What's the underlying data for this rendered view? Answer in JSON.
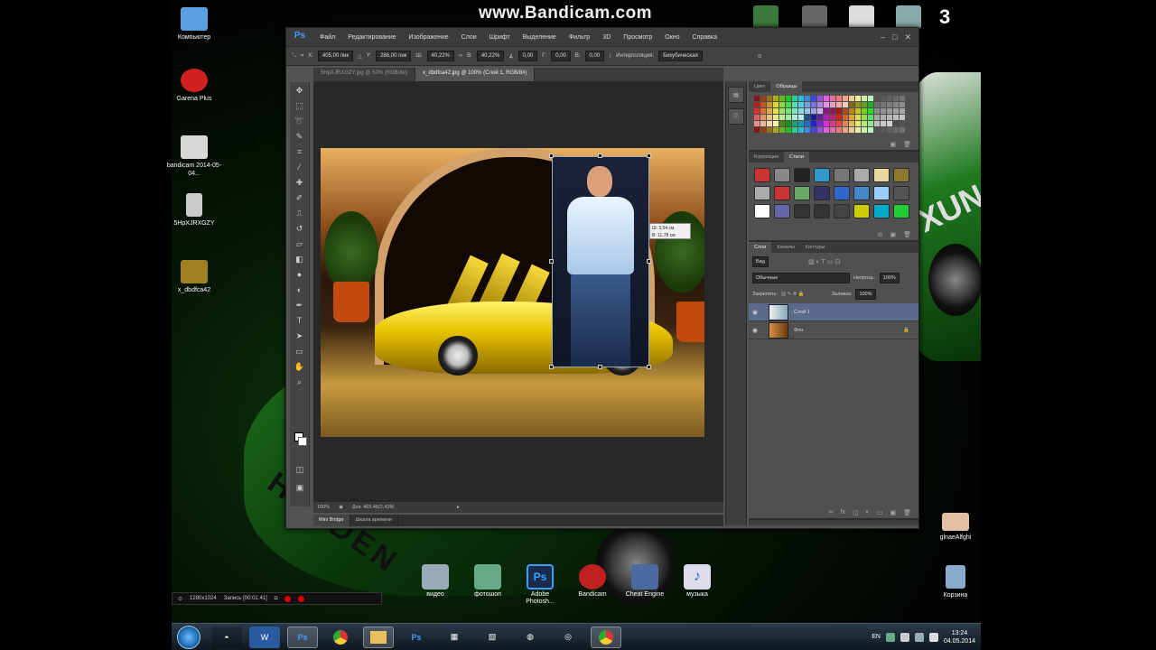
{
  "watermark": "www.Bandicam.com",
  "desktop": {
    "icons": [
      {
        "label": "Компьютер",
        "color": "#5aa0e0"
      },
      {
        "label": "Garena Plus",
        "color": "#d02020"
      },
      {
        "label": "bandicam 2014-05-04...",
        "color": "#d8d8d8"
      },
      {
        "label": "5HpXJRXGZY",
        "color": "#cccccc"
      },
      {
        "label": "x_dbdfca42",
        "color": "#a08020"
      }
    ],
    "right_icons": [
      {
        "label": "glnaeAlfghi",
        "color": "#e0c0a0"
      },
      {
        "label": "Корзина",
        "color": "#8ac"
      }
    ],
    "ps3_label": "3"
  },
  "photoshop": {
    "logo": "Ps",
    "menu": [
      "Файл",
      "Редактирование",
      "Изображение",
      "Слои",
      "Шрифт",
      "Выделение",
      "Фильтр",
      "3D",
      "Просмотр",
      "Окно",
      "Справка"
    ],
    "options": {
      "x": "405,00 пик",
      "y": "286,00 пик",
      "w": "40,22%",
      "h": "40,22%",
      "angle": "0,00",
      "h_skew": "0,00",
      "v_skew": "0,00",
      "interpolation_label": "Интерполяция:",
      "interpolation_value": "Бикубическая"
    },
    "doc_tabs": [
      {
        "label": "5HpXJRXGZY.jpg @ 50% (RGB/8#)",
        "active": false
      },
      {
        "label": "x_dbdfca42.jpg @ 100% (Слой 1, RGB/8#)",
        "active": true
      }
    ],
    "transform_tip": {
      "line1": "Ш: 3,54 см",
      "line2": "В: 11,78 см"
    },
    "status": {
      "zoom": "100%",
      "doc": "Док: 465,4К/2,42М"
    },
    "bridge_tabs": [
      {
        "label": "Mini Bridge",
        "active": true
      },
      {
        "label": "Шкала времени",
        "active": false
      }
    ],
    "swatches_tabs": [
      {
        "label": "Цвет",
        "active": false
      },
      {
        "label": "Образцы",
        "active": true
      }
    ],
    "styles_tabs": [
      {
        "label": "Коррекция",
        "active": false
      },
      {
        "label": "Стили",
        "active": true
      }
    ],
    "layers_tabs": [
      {
        "label": "Слои",
        "active": true
      },
      {
        "label": "Каналы",
        "active": false
      },
      {
        "label": "Контуры",
        "active": false
      }
    ],
    "layers": {
      "kind": "Вид",
      "blend": "Обычные",
      "opacity_label": "Непрозр.:",
      "opacity": "100%",
      "lock_label": "Закрепить:",
      "fill_label": "Заливка:",
      "fill": "100%",
      "items": [
        {
          "name": "Слой 1",
          "selected": true
        },
        {
          "name": "Фон",
          "selected": false
        }
      ]
    }
  },
  "dock": [
    {
      "label": "видео",
      "color": "#9ab"
    },
    {
      "label": "фотошоп",
      "color": "#6a8"
    },
    {
      "label": "Adobe Photosh...",
      "color": "#1a2a4a"
    },
    {
      "label": "Bandicam",
      "color": "#c02020"
    },
    {
      "label": "Cheat Engine",
      "color": "#4a6aa0"
    },
    {
      "label": "музыка",
      "color": "#dde"
    }
  ],
  "recorder": {
    "resolution": "1280x1024",
    "record": "Запись [00:01:41]"
  },
  "taskbar": {
    "lang": "EN",
    "time": "13:24",
    "date": "04.05.2014"
  },
  "colors": {
    "accent": "#3aa0ff",
    "ps_bg": "#535353",
    "selection": "#5a6a8a"
  }
}
